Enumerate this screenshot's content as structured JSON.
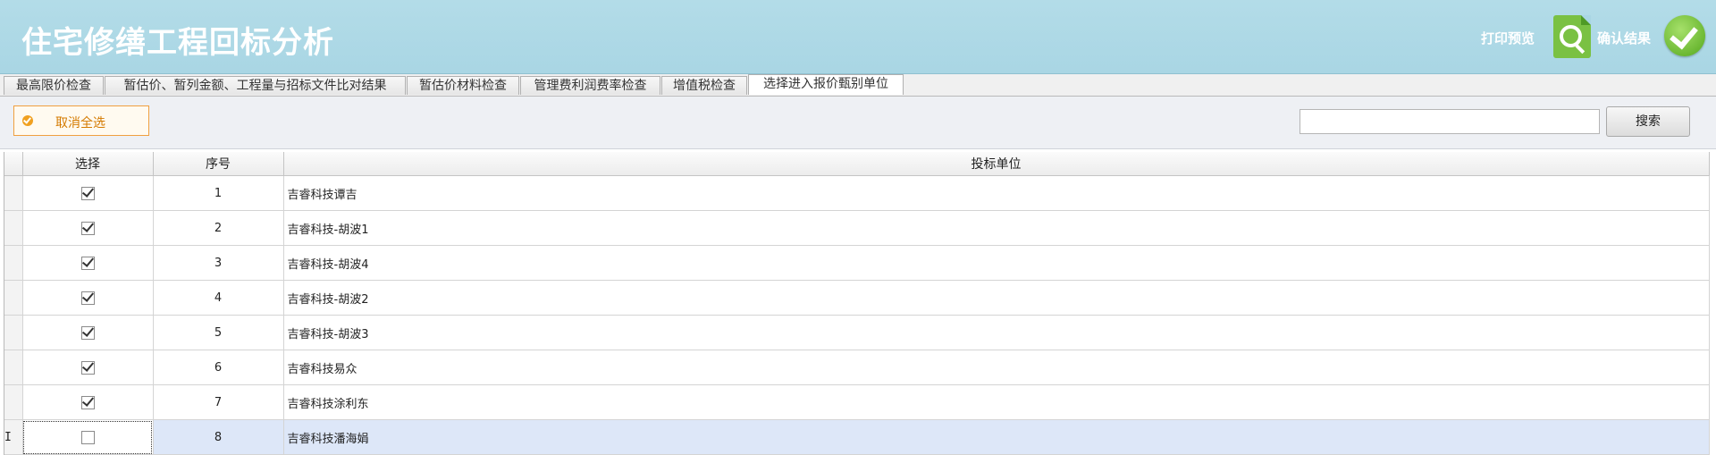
{
  "header": {
    "title": "住宅修缮工程回标分析",
    "print_preview_label": "打印预览",
    "confirm_label": "确认结果"
  },
  "tabs": [
    {
      "label": "最高限价检查"
    },
    {
      "label": "暂估价、暂列金额、工程量与招标文件比对结果"
    },
    {
      "label": "暂估价材料检查"
    },
    {
      "label": "管理费利润费率检查"
    },
    {
      "label": "增值税检查"
    },
    {
      "label": "选择进入报价甄别单位",
      "active": true
    }
  ],
  "toolbar": {
    "cancel_all_label": "取消全选",
    "search_value": "",
    "search_button_label": "搜索"
  },
  "grid": {
    "columns": {
      "select": "选择",
      "index": "序号",
      "bidder": "投标单位"
    },
    "rows": [
      {
        "checked": true,
        "index": "1",
        "bidder": "吉睿科技谭吉"
      },
      {
        "checked": true,
        "index": "2",
        "bidder": "吉睿科技-胡波1"
      },
      {
        "checked": true,
        "index": "3",
        "bidder": "吉睿科技-胡波4"
      },
      {
        "checked": true,
        "index": "4",
        "bidder": "吉睿科技-胡波2"
      },
      {
        "checked": true,
        "index": "5",
        "bidder": "吉睿科技-胡波3"
      },
      {
        "checked": true,
        "index": "6",
        "bidder": "吉睿科技易众"
      },
      {
        "checked": true,
        "index": "7",
        "bidder": "吉睿科技涂利东"
      },
      {
        "checked": false,
        "index": "8",
        "bidder": "吉睿科技潘海娟",
        "selected": true,
        "indicator": "I"
      }
    ]
  }
}
